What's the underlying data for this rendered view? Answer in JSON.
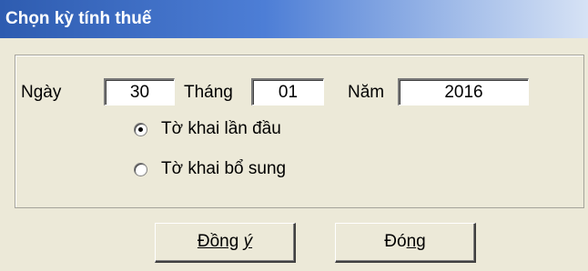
{
  "window": {
    "title": "Chọn kỳ tính thuế"
  },
  "date": {
    "day_label": "Ngày",
    "day_value": "30",
    "month_label": "Tháng",
    "month_value": "01",
    "year_label": "Năm",
    "year_value": "2016"
  },
  "options": [
    {
      "label": "Tờ khai lần đầu",
      "selected": true
    },
    {
      "label": "Tờ khai bổ sung",
      "selected": false
    }
  ],
  "buttons": {
    "ok_label_a": "Đồng",
    "ok_label_b": "ý",
    "close_label_a": "Đó",
    "close_label_b": "n",
    "close_label_c": "g"
  },
  "colors": {
    "title_bar": "#2e5cb0",
    "dialog_bg": "#ece9d8"
  },
  "icons": [
    "radio-selected-icon",
    "radio-unselected-icon"
  ]
}
